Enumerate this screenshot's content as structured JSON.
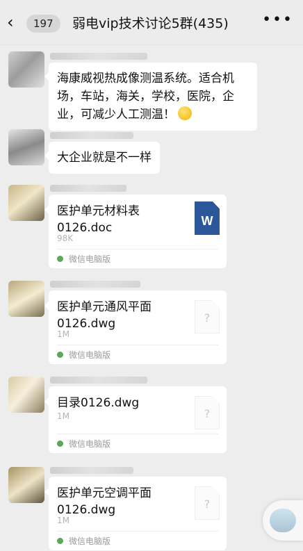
{
  "header": {
    "back_icon": "chevron-left-icon",
    "unread_count": "197",
    "title": "弱电vip技术讨论5群(435)",
    "more_icon": "more-dots-icon"
  },
  "messages": [
    {
      "type": "text",
      "text": "海康威视热成像测温系统。适合机场，车站，海关，学校，医院，企业，可减少人工测温！",
      "emoji": "grinning-sweat-emoji"
    },
    {
      "type": "text",
      "text": "大企业就是不一样"
    }
  ],
  "files": [
    {
      "name": "医护单元材料表\n0126.doc",
      "size": "98K",
      "icon": "word-doc-icon",
      "icon_letter": "W",
      "source": "微信电脑版"
    },
    {
      "name": "医护单元通风平面\n0126.dwg",
      "size": "1M",
      "icon": "unknown-file-icon",
      "icon_letter": "?",
      "source": "微信电脑版"
    },
    {
      "name": "目录0126.dwg",
      "size": "1M",
      "icon": "unknown-file-icon",
      "icon_letter": "?",
      "source": "微信电脑版"
    },
    {
      "name": "医护单元空调平面\n0126.dwg",
      "size": "1M",
      "icon": "unknown-file-icon",
      "icon_letter": "?",
      "source": "微信电脑版"
    }
  ],
  "colors": {
    "background": "#ededed",
    "bubble": "#ffffff",
    "word_blue": "#2b579a",
    "source_green": "#5aa85a"
  }
}
